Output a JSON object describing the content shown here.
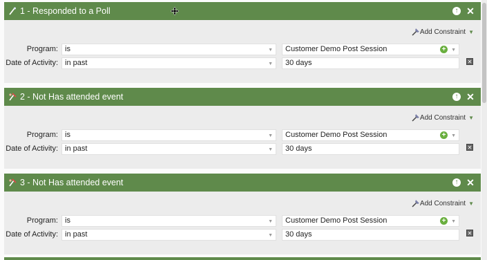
{
  "colors": {
    "header_green": "#5f8a4b",
    "plus_green": "#6aaf3f"
  },
  "filters": [
    {
      "title": "1 - Responded to a Poll",
      "icon": "wand-icon",
      "add_constraint": "Add Constraint",
      "program_label": "Program:",
      "program_operator": "is",
      "program_value": "Customer Demo Post Session",
      "date_label": "Date of Activity:",
      "date_operator": "in past",
      "date_value": "30 days"
    },
    {
      "title": "2 - Not Has attended event",
      "icon": "not-attended-icon",
      "add_constraint": "Add Constraint",
      "program_label": "Program:",
      "program_operator": "is",
      "program_value": "Customer Demo Post Session",
      "date_label": "Date of Activity:",
      "date_operator": "in past",
      "date_value": "30 days"
    },
    {
      "title": "3 - Not Has attended event",
      "icon": "not-attended-icon",
      "add_constraint": "Add Constraint",
      "program_label": "Program:",
      "program_operator": "is",
      "program_value": "Customer Demo Post Session",
      "date_label": "Date of Activity:",
      "date_operator": "in past",
      "date_value": "30 days"
    }
  ]
}
